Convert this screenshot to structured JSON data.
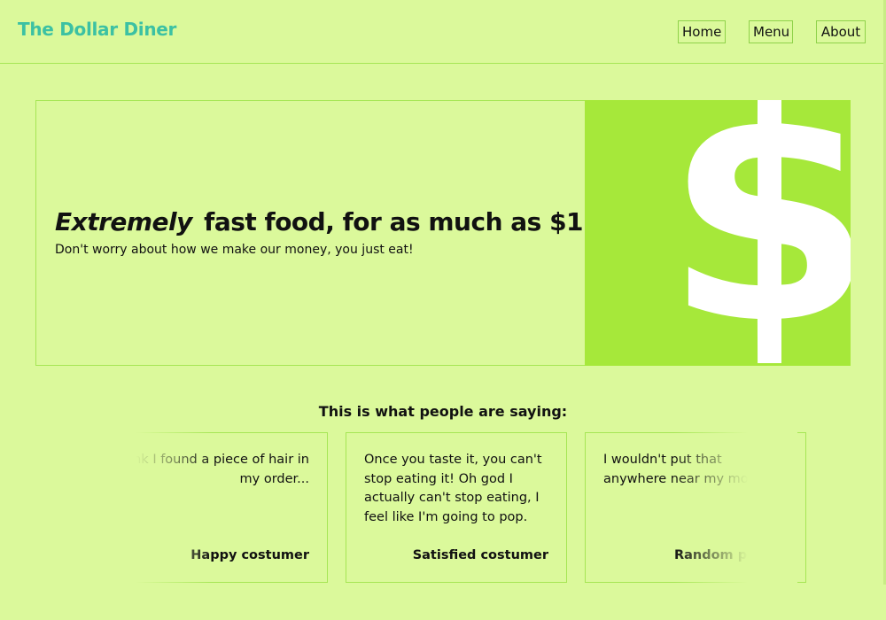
{
  "header": {
    "brand": "The Dollar Diner",
    "nav": {
      "home": "Home",
      "menu": "Menu",
      "about": "About"
    }
  },
  "hero": {
    "title_emphasis": "Extremely",
    "title_rest": "fast food, for as much as $1",
    "subtitle": "Don't worry about how we make our money, you just eat!",
    "image_glyph": "$"
  },
  "testimonials": {
    "heading": "This is what people are saying:",
    "cards": [
      {
        "quote": "I think I found a piece of hair in my order...",
        "author": "Happy costumer"
      },
      {
        "quote": "Once you taste it, you can't stop eating it! Oh god I actually can't stop eating, I feel like I'm going to pop.",
        "author": "Satisfied costumer"
      },
      {
        "quote": "I wouldn't put that anywhere near my mouth.",
        "author": "Random person"
      }
    ]
  },
  "colors": {
    "background": "#dbf99b",
    "brand": "#3cc1a3",
    "accent_green": "#a6e83a",
    "border": "#a6e655"
  }
}
